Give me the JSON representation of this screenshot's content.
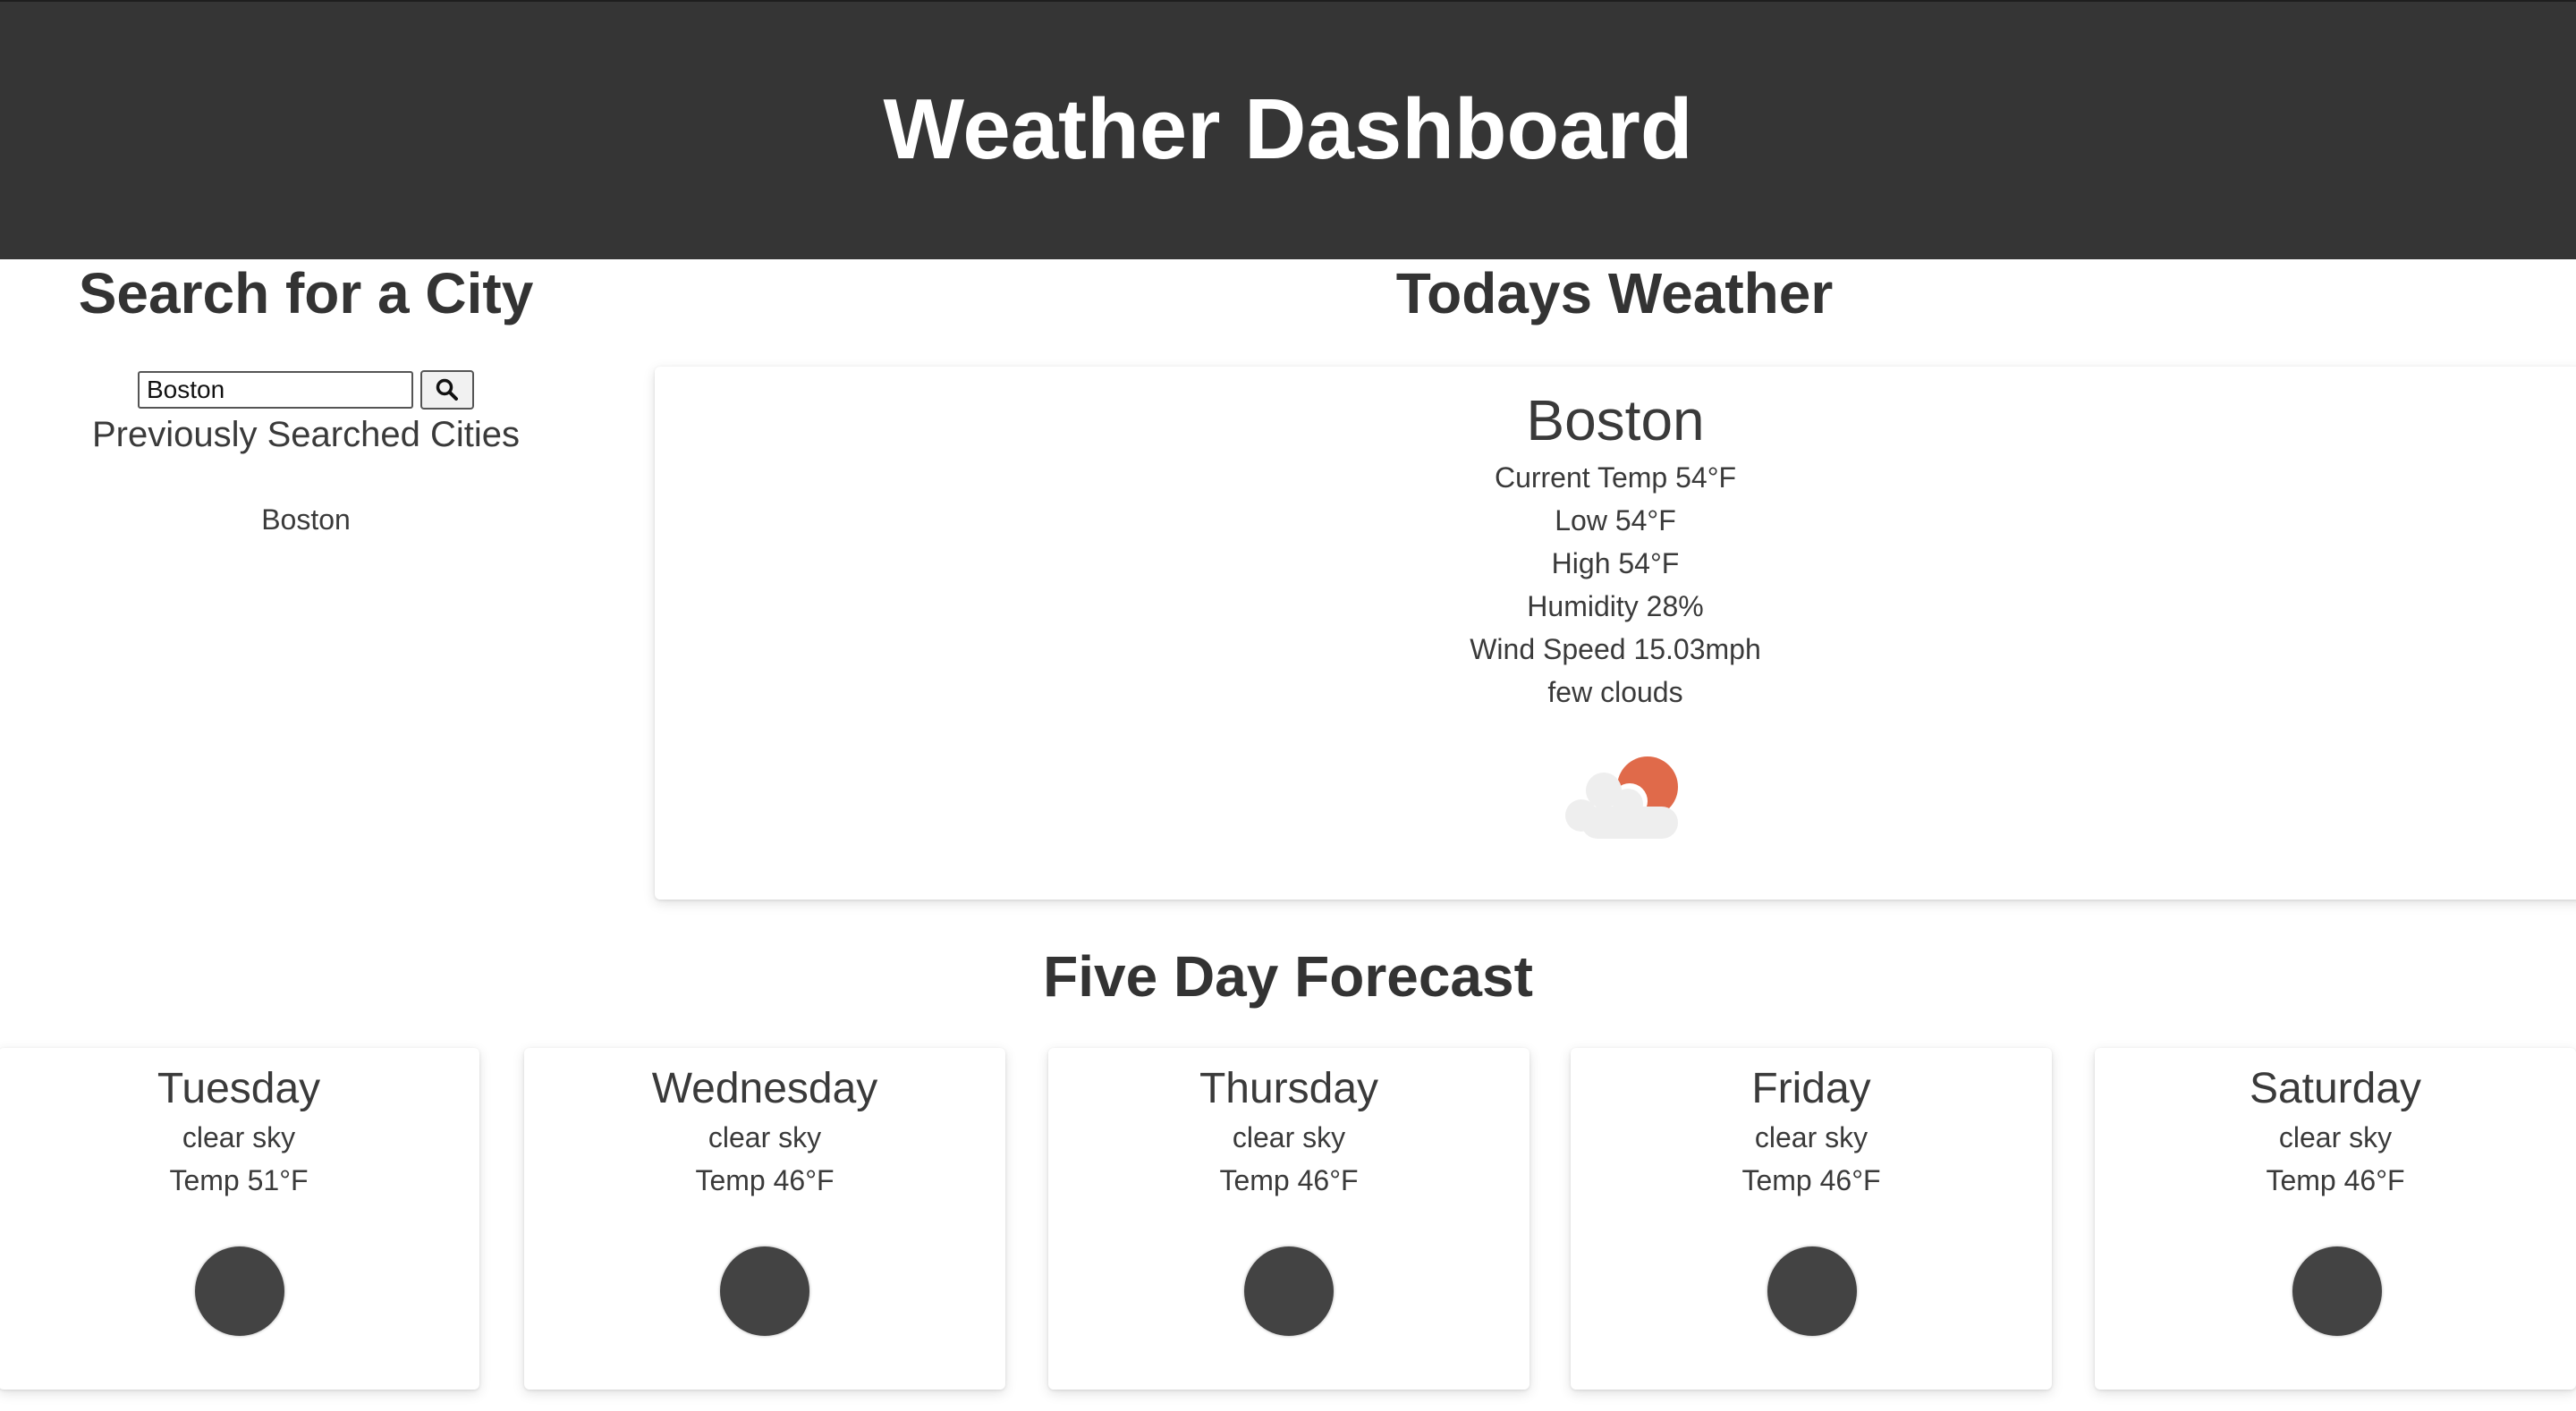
{
  "header": {
    "title": "Weather Dashboard"
  },
  "search": {
    "title": "Search for a City",
    "input_value": "Boston",
    "button_icon": "search-icon",
    "previous_title": "Previously Searched Cities",
    "previous_cities": [
      "Boston"
    ]
  },
  "today": {
    "title": "Todays Weather",
    "city": "Boston",
    "current_temp": "Current Temp 54°F",
    "low": "Low 54°F",
    "high": "High 54°F",
    "humidity": "Humidity 28%",
    "wind": "Wind Speed 15.03mph",
    "description": "few clouds",
    "icon": "few-clouds-icon"
  },
  "forecast": {
    "title": "Five Day Forecast",
    "days": [
      {
        "day": "Tuesday",
        "description": "clear sky",
        "temp": "Temp 51°F",
        "icon": "clear-sky-night-icon"
      },
      {
        "day": "Wednesday",
        "description": "clear sky",
        "temp": "Temp 46°F",
        "icon": "clear-sky-night-icon"
      },
      {
        "day": "Thursday",
        "description": "clear sky",
        "temp": "Temp 46°F",
        "icon": "clear-sky-night-icon"
      },
      {
        "day": "Friday",
        "description": "clear sky",
        "temp": "Temp 46°F",
        "icon": "clear-sky-night-icon"
      },
      {
        "day": "Saturday",
        "description": "clear sky",
        "temp": "Temp 46°F",
        "icon": "clear-sky-night-icon"
      }
    ]
  },
  "colors": {
    "header_bg": "#353535",
    "sun": "#e06a4a",
    "cloud": "#eeeeee",
    "night_icon": "#434343"
  }
}
